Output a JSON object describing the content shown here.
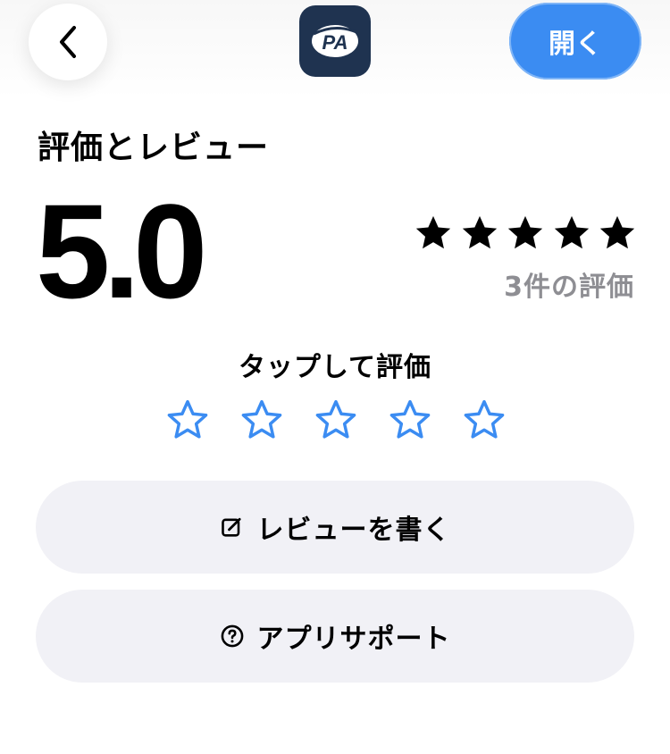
{
  "header": {
    "back_icon": "chevron-left-icon",
    "app_icon_text": "PA",
    "open_label": "開く"
  },
  "ratings": {
    "title": "評価とレビュー",
    "score": "5.0",
    "stars_filled": 5,
    "count_label": "3件の評価"
  },
  "tap_to_rate": {
    "label": "タップして評価",
    "stars": 5,
    "selected": 0
  },
  "actions": {
    "write_review": {
      "icon": "compose-icon",
      "label": "レビューを書く"
    },
    "app_support": {
      "icon": "question-circle-icon",
      "label": "アプリサポート"
    }
  },
  "colors": {
    "accent": "#3b8cf2",
    "app_icon_bg": "#1f3350",
    "secondary_text": "#8e8e93",
    "button_bg": "#f1f1f6"
  }
}
